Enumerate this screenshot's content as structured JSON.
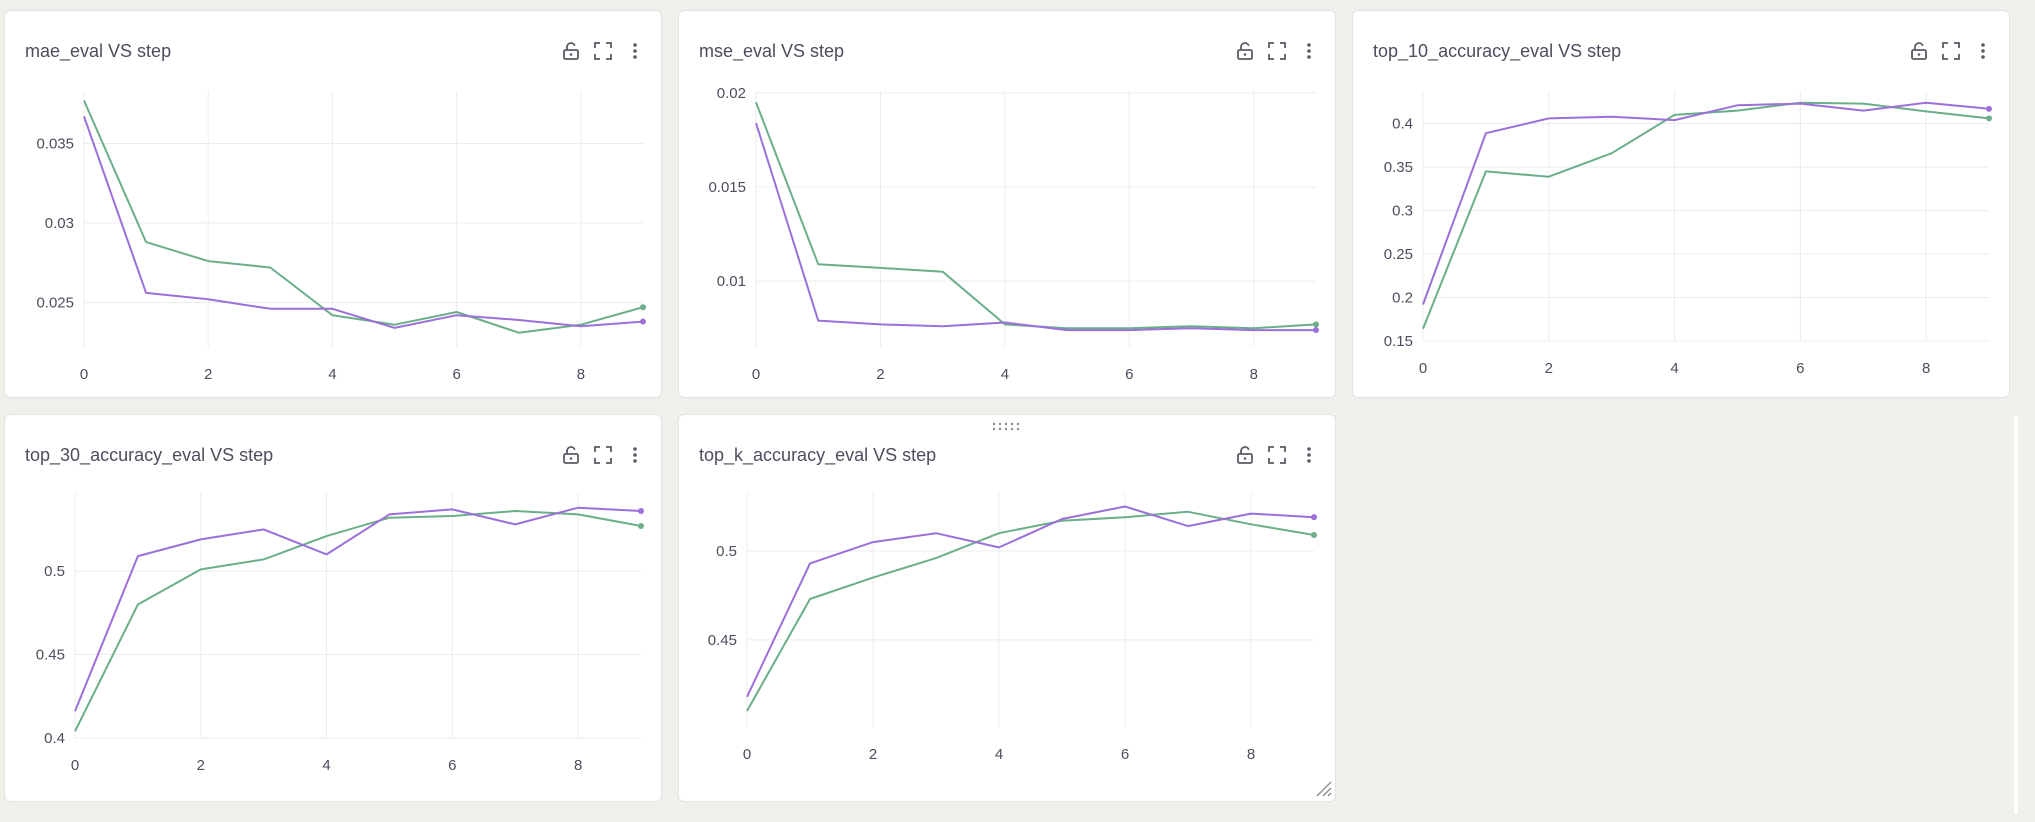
{
  "panels": [
    {
      "title": "mae_eval VS step",
      "chart_data": {
        "type": "line",
        "title": "mae_eval VS step",
        "xlabel": "",
        "ylabel": "",
        "xlim": [
          0,
          9
        ],
        "ylim": [
          0.0222,
          0.0383
        ],
        "x_ticks": [
          0,
          2,
          4,
          6,
          8
        ],
        "y_ticks": [
          0.025,
          0.03,
          0.035
        ],
        "y_tick_labels": [
          "0.025",
          "0.03",
          "0.035"
        ],
        "series": [
          {
            "color": "#6aaf89",
            "x": [
              0,
              1,
              2,
              3,
              4,
              5,
              6,
              7,
              8,
              9
            ],
            "values": [
              0.0377,
              0.0288,
              0.0276,
              0.0272,
              0.0242,
              0.0236,
              0.0244,
              0.0231,
              0.0236,
              0.0247
            ]
          },
          {
            "color": "#9c6fd9",
            "x": [
              0,
              1,
              2,
              3,
              4,
              5,
              6,
              7,
              8,
              9
            ],
            "values": [
              0.0367,
              0.0256,
              0.0252,
              0.0246,
              0.0246,
              0.0234,
              0.0242,
              0.0239,
              0.0235,
              0.0238
            ]
          }
        ]
      }
    },
    {
      "title": "mse_eval VS step",
      "chart_data": {
        "type": "line",
        "title": "mse_eval VS step",
        "xlabel": "",
        "ylabel": "",
        "xlim": [
          0,
          9
        ],
        "ylim": [
          0.0065,
          0.0201
        ],
        "x_ticks": [
          0,
          2,
          4,
          6,
          8
        ],
        "y_ticks": [
          0.01,
          0.015,
          0.02
        ],
        "y_tick_labels": [
          "0.01",
          "0.015",
          "0.02"
        ],
        "series": [
          {
            "color": "#6aaf89",
            "x": [
              0,
              1,
              2,
              3,
              4,
              5,
              6,
              7,
              8,
              9
            ],
            "values": [
              0.0195,
              0.0109,
              0.0107,
              0.0105,
              0.0077,
              0.0075,
              0.0075,
              0.0076,
              0.0075,
              0.0077
            ]
          },
          {
            "color": "#9c6fd9",
            "x": [
              0,
              1,
              2,
              3,
              4,
              5,
              6,
              7,
              8,
              9
            ],
            "values": [
              0.0184,
              0.0079,
              0.0077,
              0.0076,
              0.0078,
              0.0074,
              0.0074,
              0.0075,
              0.0074,
              0.0074
            ]
          }
        ]
      }
    },
    {
      "title": "top_10_accuracy_eval VS step",
      "chart_data": {
        "type": "line",
        "title": "top_10_accuracy_eval VS step",
        "xlabel": "",
        "ylabel": "",
        "xlim": [
          0,
          9
        ],
        "ylim": [
          0.15,
          0.4375
        ],
        "x_ticks": [
          0,
          2,
          4,
          6,
          8
        ],
        "y_ticks": [
          0.15,
          0.2,
          0.25,
          0.3,
          0.35,
          0.4
        ],
        "y_tick_labels": [
          "0.15",
          "0.2",
          "0.25",
          "0.3",
          "0.35",
          "0.4"
        ],
        "series": [
          {
            "color": "#6aaf89",
            "x": [
              0,
              1,
              2,
              3,
              4,
              5,
              6,
              7,
              8,
              9
            ],
            "values": [
              0.164,
              0.345,
              0.339,
              0.366,
              0.41,
              0.415,
              0.424,
              0.423,
              0.414,
              0.406
            ]
          },
          {
            "color": "#9c6fd9",
            "x": [
              0,
              1,
              2,
              3,
              4,
              5,
              6,
              7,
              8,
              9
            ],
            "values": [
              0.192,
              0.389,
              0.406,
              0.408,
              0.404,
              0.421,
              0.423,
              0.415,
              0.424,
              0.417
            ]
          }
        ]
      }
    },
    {
      "title": "top_30_accuracy_eval VS step",
      "chart_data": {
        "type": "line",
        "title": "top_30_accuracy_eval VS step",
        "xlabel": "",
        "ylabel": "",
        "xlim": [
          0,
          9
        ],
        "ylim": [
          0.4,
          0.5468
        ],
        "x_ticks": [
          0,
          2,
          4,
          6,
          8
        ],
        "y_ticks": [
          0.4,
          0.45,
          0.5
        ],
        "y_tick_labels": [
          "0.4",
          "0.45",
          "0.5"
        ],
        "series": [
          {
            "color": "#6aaf89",
            "x": [
              0,
              1,
              2,
              3,
              4,
              5,
              6,
              7,
              8,
              9
            ],
            "values": [
              0.404,
              0.48,
              0.501,
              0.507,
              0.521,
              0.532,
              0.533,
              0.536,
              0.534,
              0.527
            ]
          },
          {
            "color": "#9c6fd9",
            "x": [
              0,
              1,
              2,
              3,
              4,
              5,
              6,
              7,
              8,
              9
            ],
            "values": [
              0.416,
              0.509,
              0.519,
              0.525,
              0.51,
              0.534,
              0.537,
              0.528,
              0.538,
              0.536
            ]
          }
        ]
      }
    },
    {
      "title": "top_k_accuracy_eval VS step",
      "chart_data": {
        "type": "line",
        "title": "top_k_accuracy_eval VS step",
        "xlabel": "",
        "ylabel": "",
        "xlim": [
          0,
          9
        ],
        "ylim": [
          0.401,
          0.5326
        ],
        "x_ticks": [
          0,
          2,
          4,
          6,
          8
        ],
        "y_ticks": [
          0.45,
          0.5
        ],
        "y_tick_labels": [
          "0.45",
          "0.5"
        ],
        "series": [
          {
            "color": "#6aaf89",
            "x": [
              0,
              1,
              2,
              3,
              4,
              5,
              6,
              7,
              8,
              9
            ],
            "values": [
              0.41,
              0.473,
              0.485,
              0.496,
              0.51,
              0.517,
              0.519,
              0.522,
              0.515,
              0.509
            ]
          },
          {
            "color": "#9c6fd9",
            "x": [
              0,
              1,
              2,
              3,
              4,
              5,
              6,
              7,
              8,
              9
            ],
            "values": [
              0.418,
              0.493,
              0.505,
              0.51,
              0.502,
              0.518,
              0.525,
              0.514,
              0.521,
              0.519
            ]
          }
        ]
      }
    }
  ],
  "icons": {
    "lock": "unlock-icon",
    "expand": "fullscreen-icon",
    "menu": "more-vertical-icon"
  }
}
